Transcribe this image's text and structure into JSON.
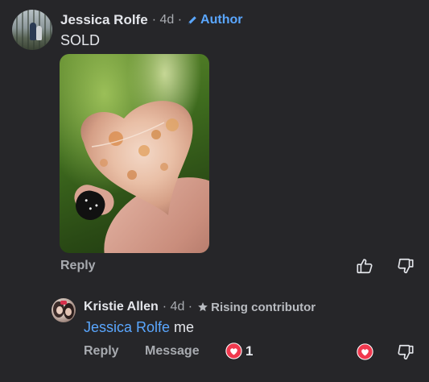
{
  "comment": {
    "author_name": "Jessica Rolfe",
    "time": "· 4d ·",
    "badge_label": "Author",
    "text": "SOLD",
    "reply_label": "Reply",
    "badge_color": "#5aa7ff"
  },
  "reply": {
    "author_name": "Kristie Allen",
    "time": "· 4d ·",
    "badge_label": "Rising contributor",
    "mention": "Jessica Rolfe",
    "text": " me",
    "reply_label": "Reply",
    "message_label": "Message",
    "reaction_count": "1",
    "reaction_color": "#f0384e"
  },
  "icons": {
    "edit": "pencil-icon",
    "star": "star-icon",
    "like": "thumbs-up-icon",
    "dislike": "thumbs-down-icon",
    "love": "heart-reaction-icon"
  }
}
